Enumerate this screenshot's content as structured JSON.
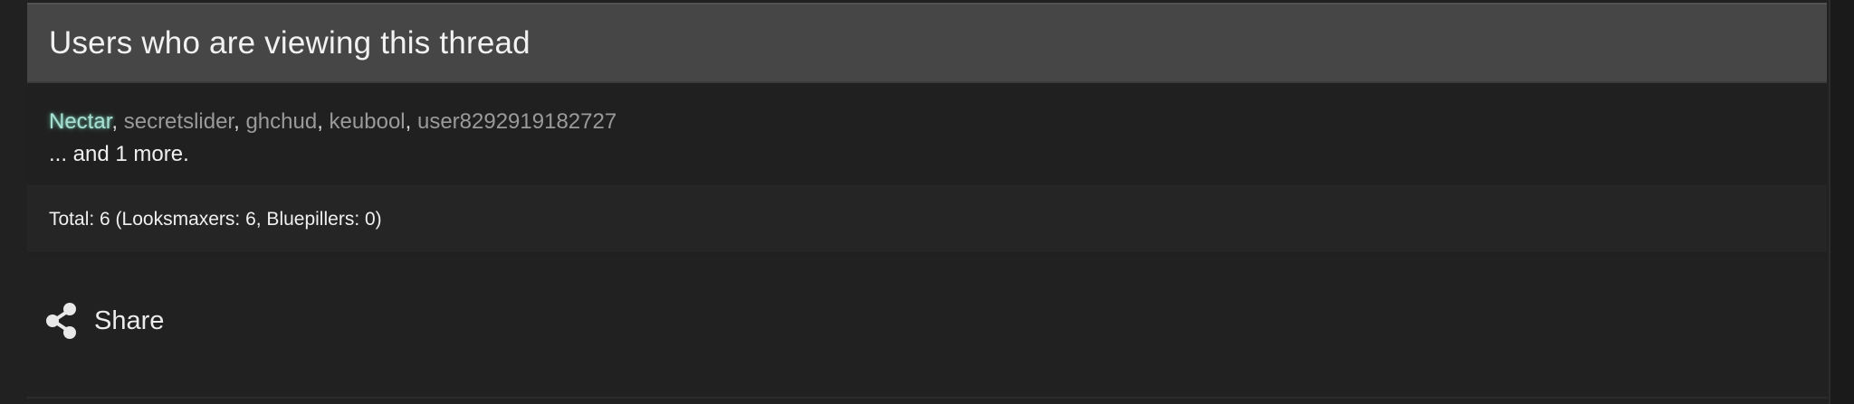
{
  "viewers": {
    "title": "Users who are viewing this thread",
    "users": [
      {
        "name": "Nectar",
        "highlight": true
      },
      {
        "name": "secretslider",
        "highlight": false
      },
      {
        "name": "ghchud",
        "highlight": false
      },
      {
        "name": "keubool",
        "highlight": false
      },
      {
        "name": "user8292919182727",
        "highlight": false
      }
    ],
    "separator": ", ",
    "more_text": "... and 1 more.",
    "total_text": "Total: 6 (Looksmaxers: 6, Bluepillers: 0)"
  },
  "share": {
    "label": "Share",
    "icon": "share-icon"
  },
  "colors": {
    "background": "#212121",
    "header": "#464646",
    "highlight_user": "#a9dfd2",
    "user_link": "#9a9a9a"
  }
}
